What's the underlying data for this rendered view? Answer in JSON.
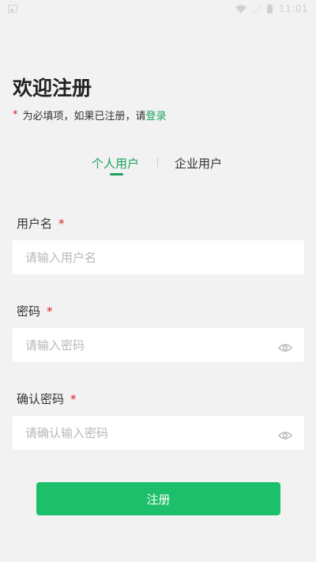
{
  "status_bar": {
    "time": "11:01",
    "icons": [
      "image-icon",
      "wifi-icon",
      "signal-icon",
      "battery-icon"
    ]
  },
  "page": {
    "title": "欢迎注册",
    "hint_star": "*",
    "hint_text": "为必填项，如果已注册，请",
    "login_link": "登录"
  },
  "tabs": {
    "personal": "个人用户",
    "enterprise": "企业用户",
    "active": "personal"
  },
  "form": {
    "username": {
      "label": "用户名",
      "required_mark": "*",
      "placeholder": "请输入用户名",
      "value": ""
    },
    "password": {
      "label": "密码",
      "required_mark": "*",
      "placeholder": "请输入密码",
      "value": "",
      "toggle_icon": "eye-icon"
    },
    "confirm_password": {
      "label": "确认密码",
      "required_mark": "*",
      "placeholder": "请确认输入密码",
      "value": "",
      "toggle_icon": "eye-icon"
    }
  },
  "actions": {
    "register_label": "注册"
  },
  "colors": {
    "accent": "#1aa35c",
    "button": "#1dbf6a",
    "required": "#e02020",
    "background": "#f2f2f2"
  }
}
